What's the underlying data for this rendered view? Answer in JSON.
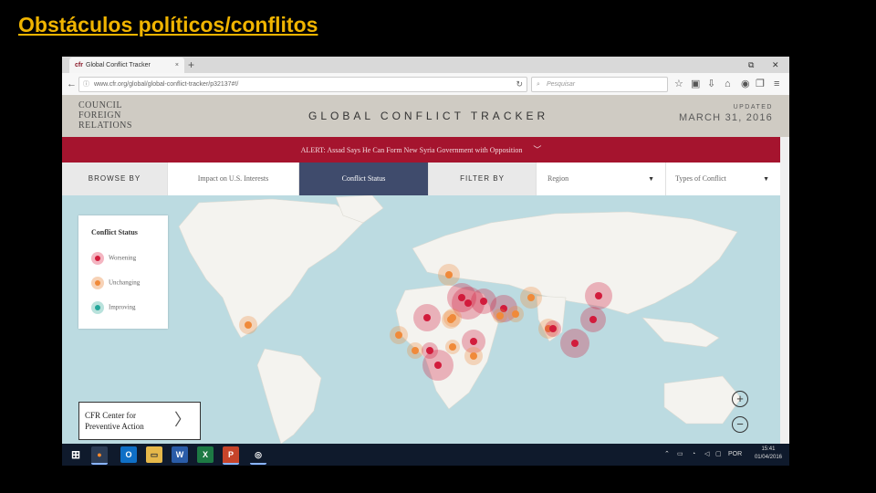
{
  "slide": {
    "title": "Obstáculos políticos/conflitos"
  },
  "browser": {
    "tab_title": "Global Conflict Tracker",
    "tab_favicon": "cfr",
    "tab_close": "×",
    "new_tab": "+",
    "url": "www.cfr.org/global/global-conflict-tracker/p32137#!/",
    "search_placeholder": "Pesquisar",
    "window_restore": "⧉",
    "window_close": "✕"
  },
  "site": {
    "logo_lines": [
      "COUNCIL",
      "FOREIGN",
      "RELATIONS"
    ],
    "logo_on": "on",
    "title": "GLOBAL CONFLICT TRACKER",
    "updated_label": "UPDATED",
    "updated_date": "MARCH 31, 2016",
    "alert": "ALERT: Assad Says He Can Form New Syria Government with Opposition"
  },
  "filterbar": {
    "browse_by": "BROWSE BY",
    "impact": "Impact on U.S. Interests",
    "conflict_status": "Conflict Status",
    "filter_by": "FILTER BY",
    "region": "Region",
    "types": "Types of Conflict"
  },
  "legend": {
    "title": "Conflict Status",
    "items": [
      {
        "label": "Worsening",
        "status": "worse"
      },
      {
        "label": "Unchanging",
        "status": "unch"
      },
      {
        "label": "Improving",
        "status": "impr"
      }
    ]
  },
  "cpr": {
    "line1": "CFR Center for",
    "line2": "Preventive Action"
  },
  "zoom": {
    "in": "+",
    "out": "−"
  },
  "colors": {
    "worsening": "#d21c3c",
    "unchanging": "#f08a3a",
    "improving": "#24a69a",
    "alert_bar": "#a5142e",
    "active_tab": "#3f4b6c",
    "title_text": "#f0b400"
  },
  "taskbar": {
    "apps": [
      "start-icon",
      "firefox-icon",
      "outlook-icon",
      "file-explorer-icon",
      "word-icon",
      "excel-icon",
      "powerpoint-icon",
      "chrome-icon"
    ],
    "lang": "POR",
    "time": "15:41",
    "date": "01/04/2016"
  }
}
